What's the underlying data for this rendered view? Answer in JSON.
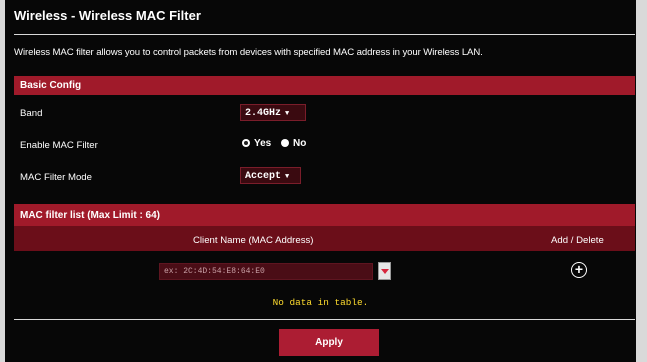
{
  "title": "Wireless - Wireless MAC Filter",
  "description": "Wireless MAC filter allows you to control packets from devices with specified MAC address in your Wireless LAN.",
  "basic_config": {
    "header": "Basic Config",
    "band": {
      "label": "Band",
      "value": "2.4GHz"
    },
    "enable": {
      "label": "Enable MAC Filter",
      "yes": "Yes",
      "no": "No",
      "selected": "Yes"
    },
    "mode": {
      "label": "MAC Filter Mode",
      "value": "Accept"
    }
  },
  "filter_list": {
    "header": "MAC filter list (Max Limit : 64)",
    "col_client": "Client Name (MAC Address)",
    "col_action": "Add / Delete",
    "input_placeholder": "ex: 2C:4D:54:E8:64:E0",
    "empty_text": "No data in table."
  },
  "apply_label": "Apply",
  "colors": {
    "accent": "#a01a2a",
    "background": "#070707",
    "empty_text": "#ffdc2e"
  },
  "icons": [
    "caret-down-icon",
    "add-circle-icon",
    "dropdown-arrow-icon"
  ]
}
